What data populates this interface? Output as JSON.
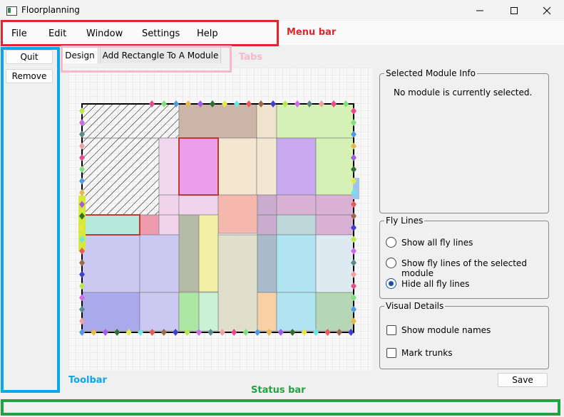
{
  "window": {
    "title": "Floorplanning",
    "minimize_icon": "minimize-icon",
    "maximize_icon": "maximize-icon",
    "close_icon": "close-icon"
  },
  "menu": {
    "items": [
      "File",
      "Edit",
      "Window",
      "Settings",
      "Help"
    ]
  },
  "toolbar": {
    "quit_label": "Quit",
    "remove_label": "Remove"
  },
  "tabs": [
    {
      "label": "Design",
      "active": true
    },
    {
      "label": "Add Rectangle To A Module",
      "active": false
    }
  ],
  "selected_module": {
    "title": "Selected Module Info",
    "text": "No module is currently selected."
  },
  "fly_lines": {
    "title": "Fly Lines",
    "options": [
      {
        "label": "Show all fly lines",
        "selected": false
      },
      {
        "label": "Show fly lines of the selected module",
        "selected": false
      },
      {
        "label": "Hide all fly lines",
        "selected": true
      }
    ]
  },
  "visual_details": {
    "title": "Visual Details",
    "options": [
      {
        "label": "Show module names",
        "checked": false
      },
      {
        "label": "Mark trunks",
        "checked": false
      }
    ]
  },
  "save_label": "Save",
  "annotations": {
    "menu_bar": "Menu bar",
    "tabs": "Tabs",
    "toolbar": "Toolbar",
    "status_bar": "Status bar"
  },
  "colors": {
    "menu_bar_annotation": "#e0262b",
    "tabs_annotation": "#f7b8cc",
    "toolbar_annotation": "#0ea5e9",
    "status_bar_annotation": "#21a344",
    "radio_selected": "#1a4fa0"
  }
}
